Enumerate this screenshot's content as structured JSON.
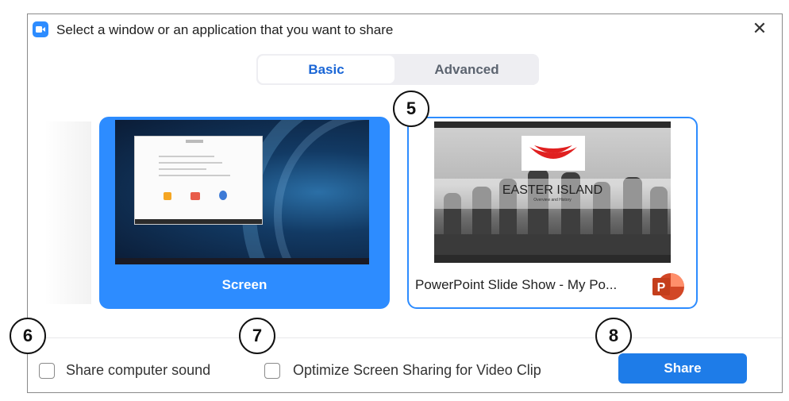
{
  "window": {
    "title": "Select a window or an application that you want to share",
    "close_icon": "close-icon",
    "app_icon": "zoom-video-icon",
    "accent_color": "#2d8cff"
  },
  "tabs": [
    {
      "label": "Basic",
      "selected": true
    },
    {
      "label": "Advanced",
      "selected": false
    }
  ],
  "share_options": [
    {
      "label": "Screen",
      "selected": true
    },
    {
      "label": "PowerPoint Slide Show  -  My Po...",
      "selected": false,
      "icon": "powerpoint-icon",
      "preview": {
        "title": "EASTER ISLAND",
        "subtitle": "Overview and History"
      }
    }
  ],
  "footer": {
    "share_sound_label": "Share computer sound",
    "share_sound_checked": false,
    "optimize_label": "Optimize Screen Sharing for Video Clip",
    "optimize_checked": false,
    "share_button": "Share"
  },
  "callouts": [
    "5",
    "6",
    "7",
    "8"
  ]
}
